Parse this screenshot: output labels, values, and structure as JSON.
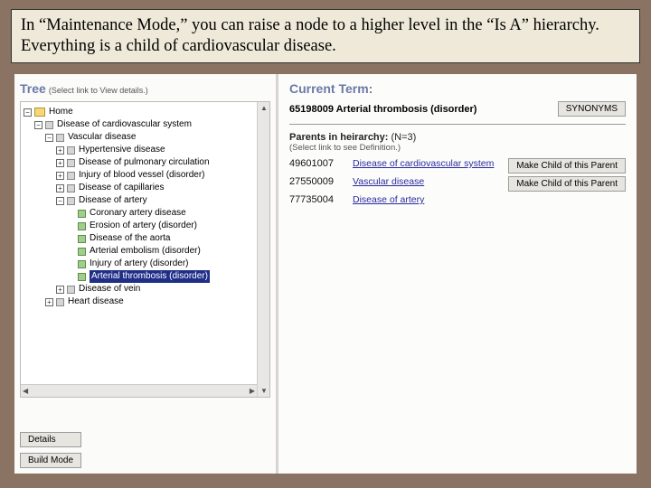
{
  "banner": "In “Maintenance Mode,” you can raise a node to a higher level in the “Is A” hierarchy.  Everything is a child of cardiovascular disease.",
  "left": {
    "title": "Tree",
    "subtitle": "(Select link to View details.)",
    "details_btn": "Details",
    "build_btn": "Build Mode",
    "nodes": {
      "home": "Home",
      "dcs": "Disease of cardiovascular system",
      "vasc": "Vascular disease",
      "hyper": "Hypertensive disease",
      "pulm": "Disease of pulmonary circulation",
      "inj_bv": "Injury of blood vessel (disorder)",
      "cap": "Disease of capillaries",
      "artery": "Disease of artery",
      "cad": "Coronary artery disease",
      "erosion": "Erosion of artery (disorder)",
      "aorta": "Disease of the aorta",
      "embolism": "Arterial embolism (disorder)",
      "inj_art": "Injury of artery (disorder)",
      "arth": "Arterial thrombosis (disorder)",
      "vein": "Disease of vein",
      "heart": "Heart disease"
    }
  },
  "right": {
    "title": "Current Term:",
    "term_id": "65198009",
    "term_label": "Arterial thrombosis (disorder)",
    "syn_btn": "SYNONYMS",
    "parents_head": "Parents in heirarchy:",
    "parents_n": "(N=3)",
    "parents_sub": "(Select link to see Definition.)",
    "make_btn": "Make Child of this Parent",
    "parents": [
      {
        "id": "49601007",
        "label": "Disease of cardiovascular system",
        "btn": true
      },
      {
        "id": "27550009",
        "label": "Vascular disease",
        "btn": true
      },
      {
        "id": "77735004",
        "label": "Disease of artery",
        "btn": false
      }
    ]
  }
}
